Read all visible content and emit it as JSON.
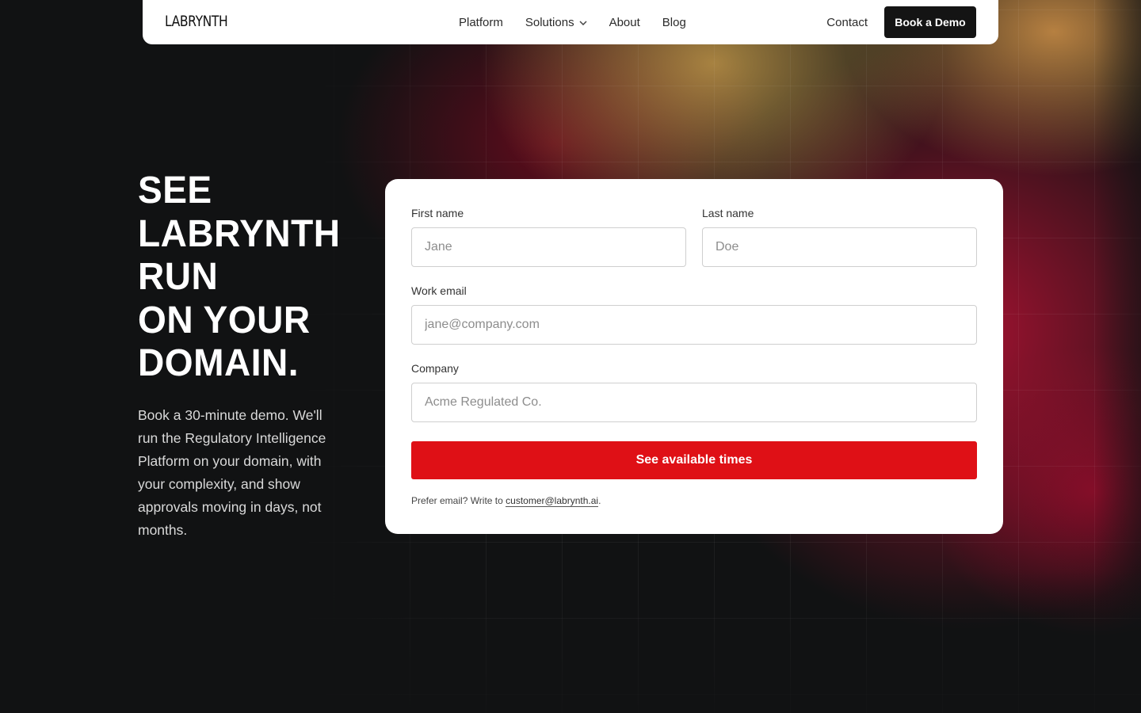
{
  "brand": {
    "logo": "LABRYNTH"
  },
  "nav": {
    "links": [
      {
        "label": "Platform"
      },
      {
        "label": "Solutions",
        "has_dropdown": true
      },
      {
        "label": "About"
      },
      {
        "label": "Blog"
      }
    ],
    "contact": "Contact",
    "cta": "Book a Demo"
  },
  "hero": {
    "title_lines": [
      "SEE",
      "LABRYNTH",
      "RUN",
      "ON YOUR",
      "DOMAIN."
    ],
    "subtitle": "Book a 30-minute demo. We'll run the Regulatory Intelligence Platform on your domain, with your complexity, and show approvals moving in days, not months."
  },
  "form": {
    "first_name": {
      "label": "First name",
      "placeholder": "Jane",
      "value": ""
    },
    "last_name": {
      "label": "Last name",
      "placeholder": "Doe",
      "value": ""
    },
    "work_email": {
      "label": "Work email",
      "placeholder": "jane@company.com",
      "value": ""
    },
    "company": {
      "label": "Company",
      "placeholder": "Acme Regulated Co.",
      "value": ""
    },
    "submit": "See available times",
    "footnote_prefix": "Prefer email? Write to ",
    "footnote_email": "customer@labrynth.ai",
    "footnote_suffix": "."
  },
  "colors": {
    "accent_red": "#df1016",
    "nav_button": "#141414",
    "background": "#111213"
  },
  "icons": {
    "solutions_dropdown": "chevron-down-icon"
  }
}
